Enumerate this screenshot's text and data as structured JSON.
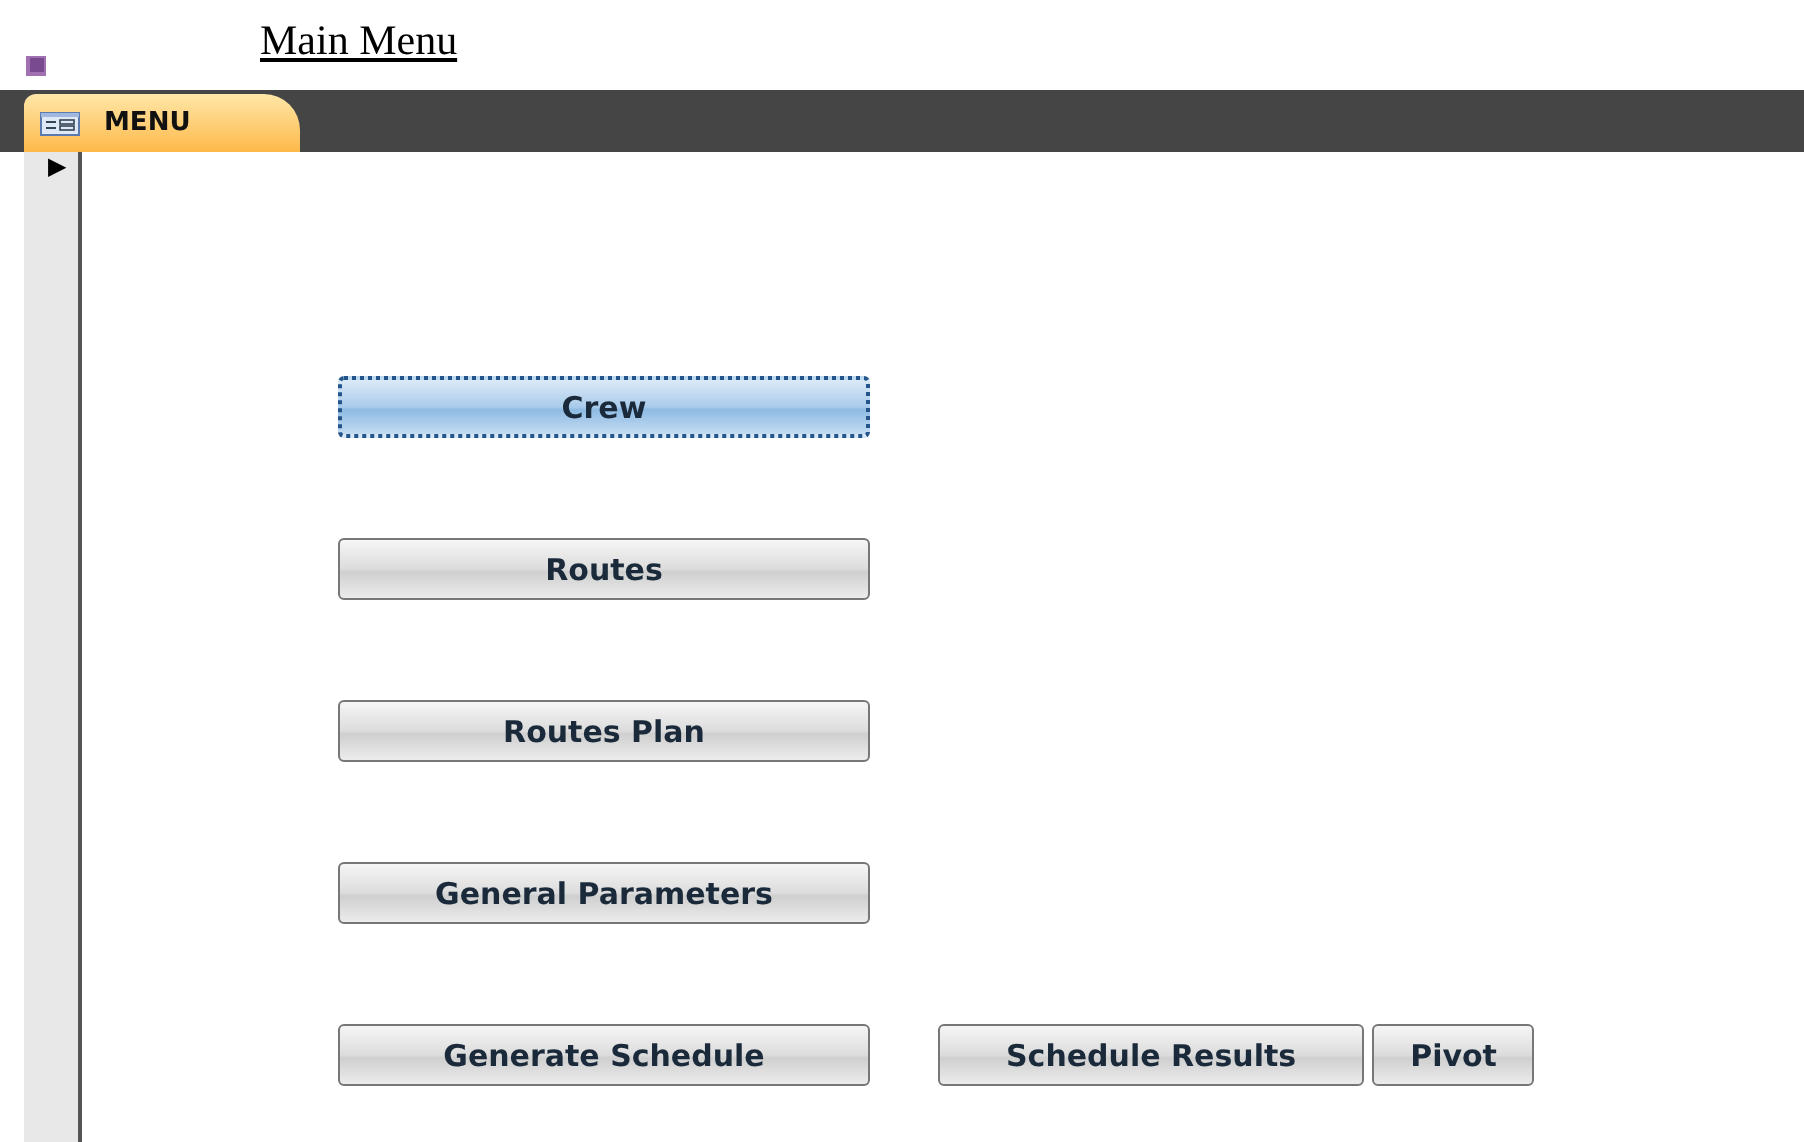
{
  "form_title": "Main Menu",
  "tab": {
    "label": "MENU",
    "selected": true
  },
  "record_selector": "▶",
  "button_rows": [
    [
      {
        "label": "Crew",
        "focused": true
      }
    ],
    [
      {
        "label": "Routes",
        "focused": false
      }
    ],
    [
      {
        "label": "Routes Plan",
        "focused": false
      }
    ],
    [
      {
        "label": "General Parameters",
        "focused": false
      }
    ],
    [
      {
        "label": "Generate Schedule",
        "focused": false
      },
      {
        "label": "Schedule Results",
        "focused": false
      },
      {
        "label": "Pivot",
        "focused": false
      }
    ]
  ]
}
